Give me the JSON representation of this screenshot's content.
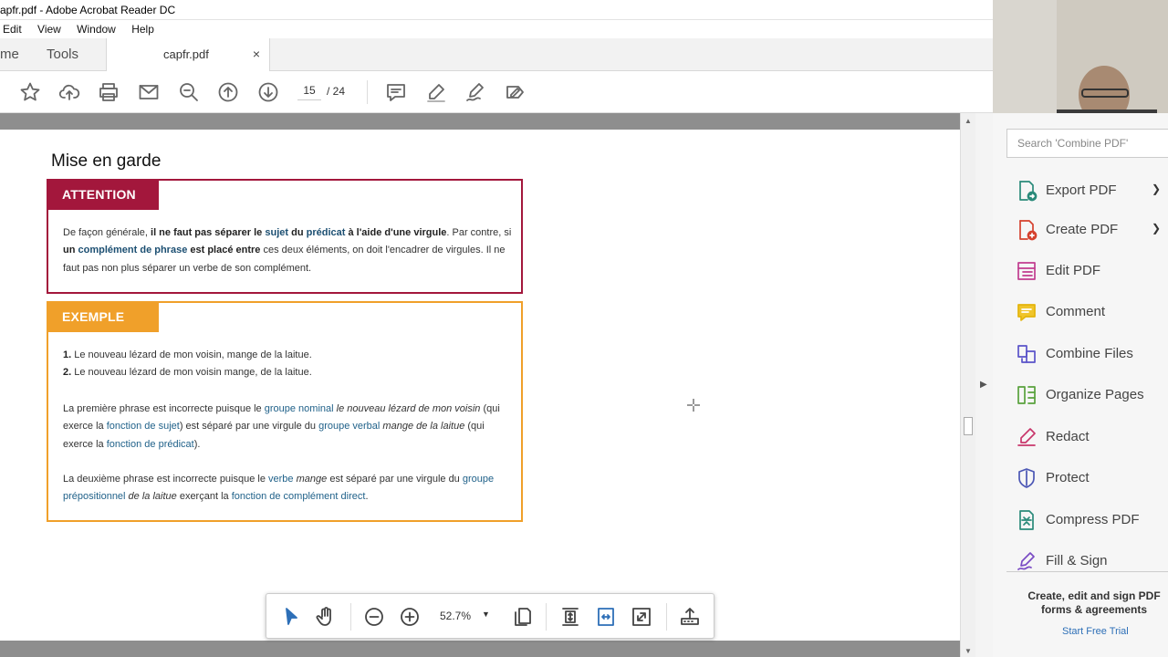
{
  "window": {
    "title": "capfr.pdf - Adobe Acrobat Reader DC"
  },
  "menu": [
    "Edit",
    "View",
    "Window",
    "Help"
  ],
  "tabs": {
    "home": "me",
    "tools": "Tools",
    "document": "capfr.pdf",
    "close": "×"
  },
  "toolbar": {
    "current_page": "15",
    "total_pages": "/  24"
  },
  "document": {
    "heading": "Mise en garde",
    "attention": {
      "title": "ATTENTION",
      "t1": "De façon générale, ",
      "t2": "il ne faut pas séparer le ",
      "t3": "sujet",
      "t4": " du ",
      "t5": "prédicat",
      "t6": " à l'aide d'une virgule",
      "t7": ". Par contre, si ",
      "t8": "un ",
      "t9": "complément de phrase",
      "t10": " est placé entre",
      "t11": " ces deux éléments, on doit l'encadrer de virgules. Il ne faut pas non plus séparer un verbe de son complément."
    },
    "example": {
      "title": "EXEMPLE",
      "l1_num": "1.",
      "l1": " Le nouveau lézard de mon voisin, mange de la laitue.",
      "l2_num": "2.",
      "l2": " Le nouveau lézard de mon voisin mange, de la laitue.",
      "p1a": "La première phrase est incorrecte puisque le ",
      "p1b": "groupe nominal",
      "p1c": " le nouveau lézard de mon voisin",
      "p1d": " (qui exerce la ",
      "p1e": "fonction de sujet",
      "p1f": ") est séparé par une virgule du ",
      "p1g": "groupe verbal",
      "p1h": " mange de la laitue",
      "p1i": " (qui exerce la ",
      "p1j": "fonction de prédicat",
      "p1k": ").",
      "p2a": "La deuxième phrase est incorrecte puisque le ",
      "p2b": "verbe",
      "p2c": " mange",
      "p2d": " est séparé par une virgule du ",
      "p2e": "groupe prépositionnel",
      "p2f": " de la laitue",
      "p2g": " exerçant la ",
      "p2h": "fonction de complément direct",
      "p2i": "."
    }
  },
  "floating_toolbar": {
    "zoom": "52.7%"
  },
  "right_pane": {
    "search_placeholder": "Search 'Combine PDF'",
    "tools": [
      {
        "label": "Export PDF",
        "icon": "export-pdf-icon",
        "color": "#2a8a7a"
      },
      {
        "label": "Create PDF",
        "icon": "create-pdf-icon",
        "color": "#d5412e"
      },
      {
        "label": "Edit PDF",
        "icon": "edit-pdf-icon",
        "color": "#c13c8f"
      },
      {
        "label": "Comment",
        "icon": "comment-icon",
        "color": "#e3b40b"
      },
      {
        "label": "Combine Files",
        "icon": "combine-files-icon",
        "color": "#5a53c9"
      },
      {
        "label": "Organize Pages",
        "icon": "organize-pages-icon",
        "color": "#58a23c"
      },
      {
        "label": "Redact",
        "icon": "redact-icon",
        "color": "#c8366b"
      },
      {
        "label": "Protect",
        "icon": "protect-icon",
        "color": "#4b56b5"
      },
      {
        "label": "Compress PDF",
        "icon": "compress-pdf-icon",
        "color": "#2a8a7a"
      },
      {
        "label": "Fill & Sign",
        "icon": "fill-sign-icon",
        "color": "#7a4bc4"
      }
    ],
    "promo": "Create, edit and sign PDF forms & agreements",
    "trial_link": "Start Free Trial"
  }
}
